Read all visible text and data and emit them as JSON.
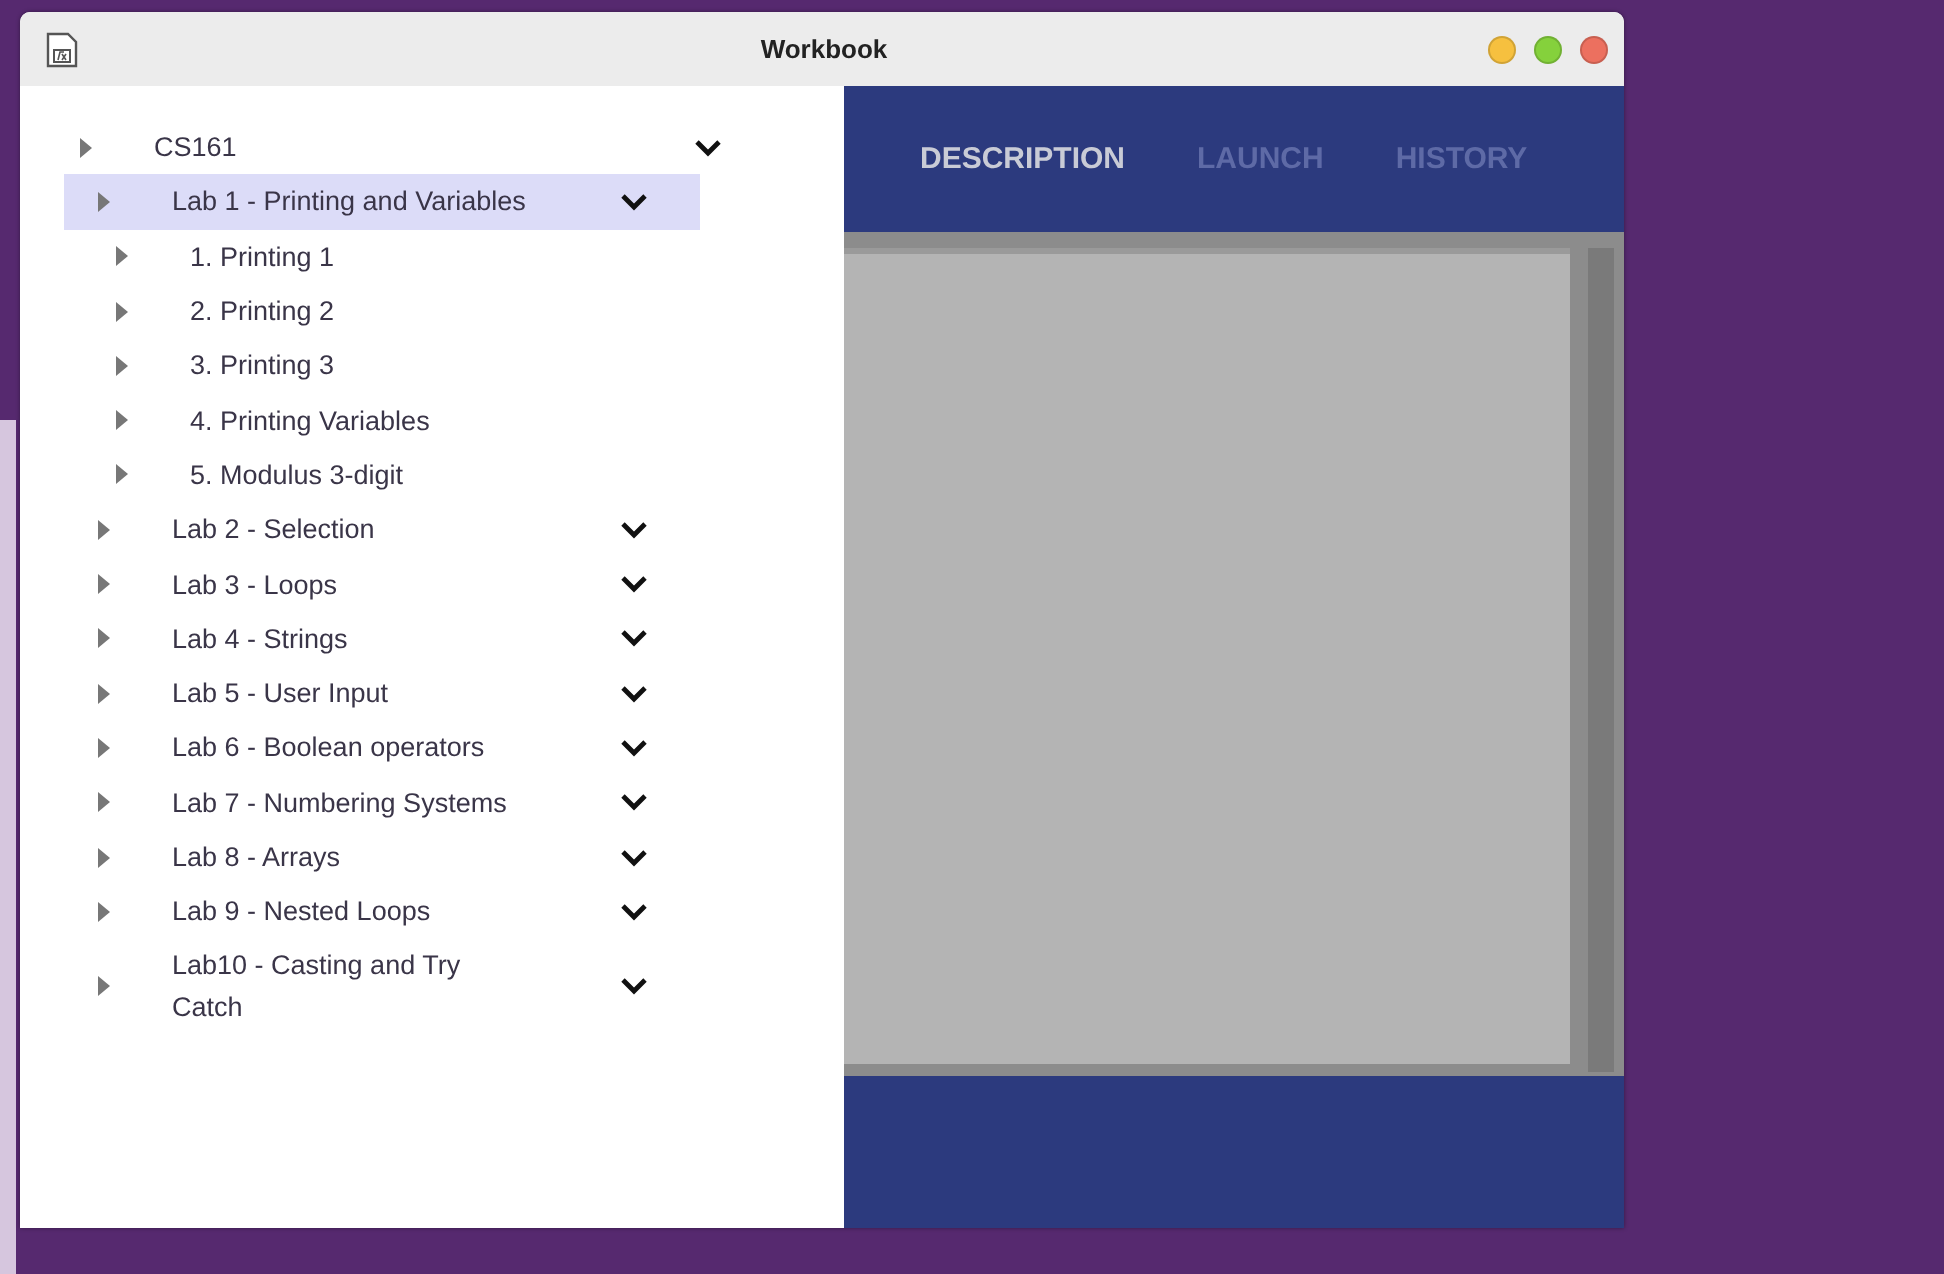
{
  "window": {
    "title": "Workbook"
  },
  "tree": [
    {
      "label": "CS161",
      "selected": false,
      "children": [
        {
          "label": "Lab 1 - Printing and Variables",
          "selected": true,
          "children": [
            {
              "label": "1. Printing 1",
              "selected": false
            },
            {
              "label": "2. Printing 2",
              "selected": false
            },
            {
              "label": "3. Printing 3",
              "selected": false
            },
            {
              "label": "4. Printing Variables",
              "selected": false
            },
            {
              "label": "5. Modulus 3-digit",
              "selected": false
            }
          ]
        },
        {
          "label": "Lab 2 - Selection",
          "selected": false
        },
        {
          "label": "Lab 3 - Loops",
          "selected": false
        },
        {
          "label": "Lab 4 - Strings",
          "selected": false
        },
        {
          "label": "Lab 5 - User Input",
          "selected": false
        },
        {
          "label": "Lab 6 - Boolean operators",
          "selected": false
        },
        {
          "label": "Lab 7 - Numbering Systems",
          "selected": false
        },
        {
          "label": "Lab 8 - Arrays",
          "selected": false
        },
        {
          "label": "Lab 9 - Nested Loops",
          "selected": false
        },
        {
          "label": "Lab10 - Casting and Try Catch",
          "selected": false
        }
      ]
    }
  ],
  "tabs": [
    {
      "label": "DESCRIPTION",
      "selected": true
    },
    {
      "label": "LAUNCH",
      "selected": false
    },
    {
      "label": "HISTORY",
      "selected": false
    }
  ]
}
